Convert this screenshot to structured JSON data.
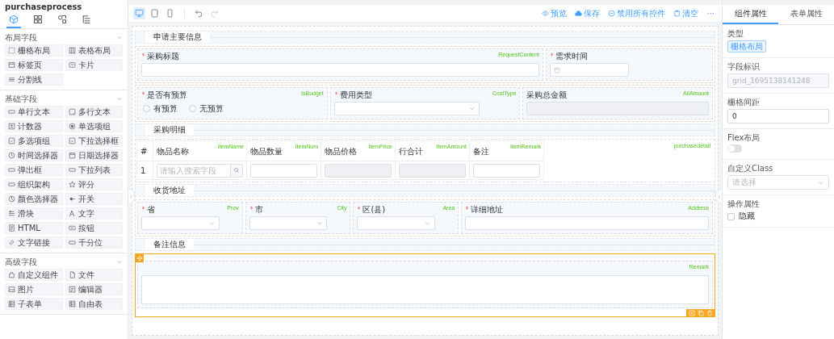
{
  "app": {
    "title": "purchaseprocess"
  },
  "sidebar": {
    "tabs": [
      {
        "kind": "cube",
        "selected": true
      },
      {
        "kind": "blocks",
        "selected": false
      },
      {
        "kind": "shapes",
        "selected": false
      },
      {
        "kind": "outline",
        "selected": false
      }
    ],
    "groups": [
      {
        "title": "布局字段",
        "expanded": true,
        "items": [
          {
            "label": "栅格布局"
          },
          {
            "label": "表格布局"
          },
          {
            "label": "标签页"
          },
          {
            "label": "卡片"
          },
          {
            "label": "分割线"
          }
        ]
      },
      {
        "title": "基础字段",
        "expanded": true,
        "items": [
          {
            "label": "单行文本"
          },
          {
            "label": "多行文本"
          },
          {
            "label": "计数器"
          },
          {
            "label": "单选项组"
          },
          {
            "label": "多选项组"
          },
          {
            "label": "下拉选择框"
          },
          {
            "label": "时间选择器"
          },
          {
            "label": "日期选择器"
          },
          {
            "label": "弹出框"
          },
          {
            "label": "下拉列表"
          },
          {
            "label": "组织架构"
          },
          {
            "label": "评分"
          },
          {
            "label": "颜色选择器"
          },
          {
            "label": "开关"
          },
          {
            "label": "滑块"
          },
          {
            "label": "文字",
            "glyph": "A"
          },
          {
            "label": "HTML"
          },
          {
            "label": "按钮"
          },
          {
            "label": "文字链接"
          },
          {
            "label": "千分位"
          }
        ]
      },
      {
        "title": "高级字段",
        "expanded": true,
        "items": [
          {
            "label": "自定义组件"
          },
          {
            "label": "文件"
          },
          {
            "label": "图片"
          },
          {
            "label": "编辑器"
          },
          {
            "label": "子表单"
          },
          {
            "label": "自由表"
          }
        ]
      }
    ]
  },
  "toolbar": {
    "devices": [
      {
        "kind": "desktop",
        "selected": true
      },
      {
        "kind": "tablet",
        "selected": false
      },
      {
        "kind": "mobile",
        "selected": false
      }
    ],
    "history": [
      {
        "kind": "undo",
        "disabled": false
      },
      {
        "kind": "redo",
        "disabled": true
      }
    ],
    "actions": [
      {
        "label": "预览"
      },
      {
        "label": "保存"
      },
      {
        "label": "禁用所有控件"
      },
      {
        "label": "清空"
      }
    ],
    "more": "···"
  },
  "form": {
    "sections": [
      {
        "title": "申请主要信息",
        "rows": [
          {
            "selected": false,
            "fields": [
              {
                "kind": "input",
                "label": "采购标题",
                "required": true,
                "field_name": "RequestContent"
              },
              {
                "kind": "date",
                "label": "需求时间",
                "required": true
              }
            ]
          },
          {
            "selected": false,
            "fields": [
              {
                "kind": "radio",
                "label": "是否有预算",
                "required": true,
                "field_name": "IsBudget",
                "options": [
                  {
                    "label": "有预算",
                    "selected": false
                  },
                  {
                    "label": "无预算",
                    "selected": false
                  }
                ]
              },
              {
                "kind": "select",
                "label": "费用类型",
                "required": true,
                "field_name": "CostType"
              },
              {
                "kind": "readonly",
                "label": "采购总金额",
                "required": false,
                "field_name": "AllAmount"
              }
            ]
          }
        ]
      },
      {
        "title": "采购明细",
        "table": {
          "field_name": "purchasedetail",
          "columns": [
            {
              "label": "#"
            },
            {
              "label": "物品名称",
              "field_name": "ItemName"
            },
            {
              "label": "物品数量",
              "field_name": "ItemNum"
            },
            {
              "label": "物品价格",
              "field_name": "ItemPrice"
            },
            {
              "label": "行合计",
              "field_name": "ItemAmount"
            },
            {
              "label": "备注",
              "field_name": "ItemRemark"
            }
          ],
          "rows": [
            {
              "cells": [
                {
                  "kind": "text",
                  "text": "1"
                },
                {
                  "kind": "search",
                  "placeholder": "请输入搜索字段"
                },
                {
                  "kind": "input"
                },
                {
                  "kind": "readonly"
                },
                {
                  "kind": "readonly"
                },
                {
                  "kind": "input"
                }
              ]
            }
          ]
        }
      },
      {
        "title": "收货地址",
        "rows": [
          {
            "selected": false,
            "fields": [
              {
                "kind": "select",
                "label": "省",
                "required": true,
                "field_name": "Prov"
              },
              {
                "kind": "select",
                "label": "市",
                "required": true,
                "field_name": "City"
              },
              {
                "kind": "select",
                "label": "区(县)",
                "required": true,
                "field_name": "Area"
              },
              {
                "kind": "input",
                "label": "详细地址",
                "required": true,
                "field_name": "Address"
              }
            ]
          }
        ]
      },
      {
        "title": "备注信息",
        "rows": [
          {
            "selected": true,
            "fields": [
              {
                "kind": "textarea",
                "required": false,
                "field_name": "Remark"
              }
            ]
          }
        ]
      }
    ]
  },
  "properties": {
    "tabs": [
      {
        "label": "组件属性",
        "selected": true
      },
      {
        "label": "表单属性",
        "selected": false
      }
    ],
    "items": [
      {
        "kind": "tag",
        "label": "类型",
        "value": "栅格布局"
      },
      {
        "kind": "input",
        "label": "字段标识",
        "value": "grid_1695138141248",
        "disabled": true
      },
      {
        "kind": "input",
        "label": "栅格间距",
        "value": "0",
        "disabled": false
      },
      {
        "kind": "switch",
        "label": "Flex布局",
        "on": false
      },
      {
        "kind": "select",
        "label": "自定义Class",
        "placeholder": "请选择"
      },
      {
        "kind": "checkbox",
        "label": "操作属性",
        "options": [
          {
            "label": "隐藏",
            "checked": false
          }
        ]
      }
    ]
  }
}
